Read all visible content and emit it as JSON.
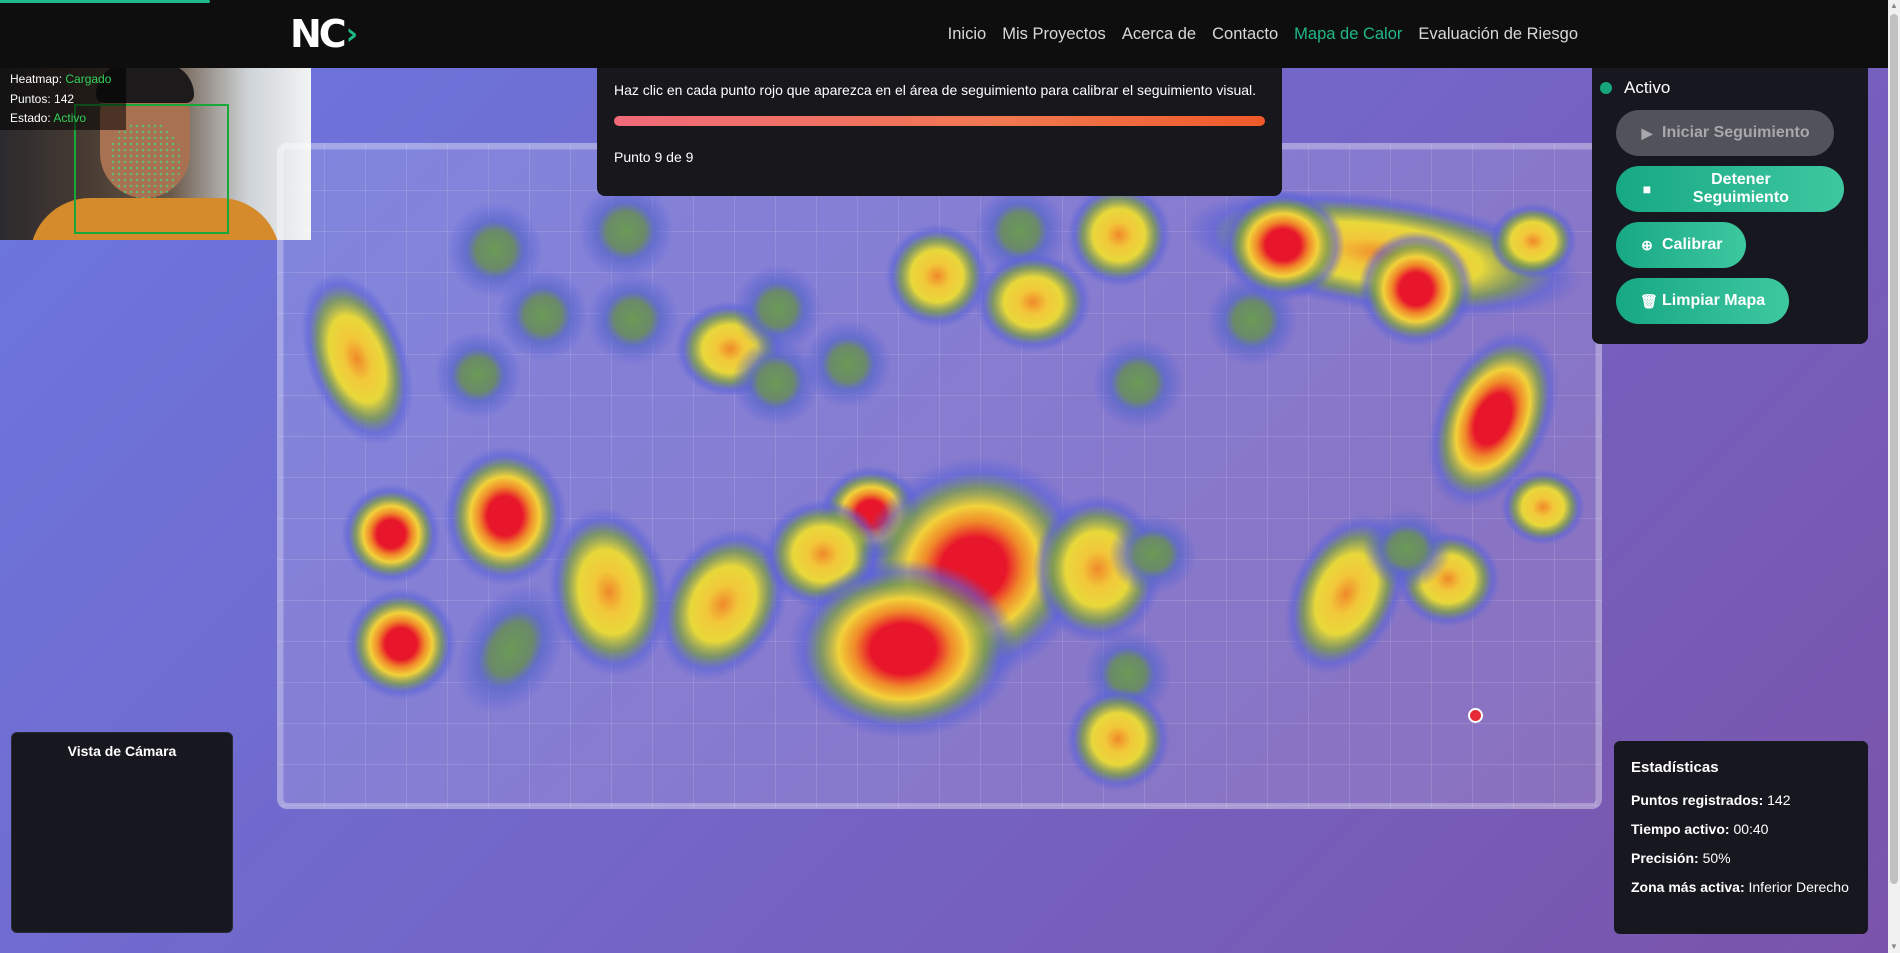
{
  "nav": {
    "logo": "NC",
    "links": [
      "Inicio",
      "Mis Proyectos",
      "Acerca de",
      "Contacto",
      "Mapa de Calor",
      "Evaluación de Riesgo"
    ],
    "active": "Mapa de Calor"
  },
  "camera_overlay": {
    "heatmap_label": "Heatmap:",
    "heatmap_value": "Cargado",
    "points_label": "Puntos:",
    "points_value": "142",
    "state_label": "Estado:",
    "state_value": "Activo"
  },
  "instructions": {
    "text": "Haz clic en cada punto rojo que aparezca en el área de seguimiento para calibrar el seguimiento visual.",
    "progress": 1.0,
    "point_label": "Punto 9 de 9"
  },
  "controls": {
    "status": "Activo",
    "start_label": "Iniciar Seguimiento",
    "stop_label": "Detener Seguimiento",
    "calibrate_label": "Calibrar",
    "clear_label": "Limpiar Mapa"
  },
  "camera_view": {
    "title": "Vista de Cámara"
  },
  "stats": {
    "title": "Estadísticas",
    "points_label": "Puntos registrados:",
    "points_value": "142",
    "time_label": "Tiempo activo:",
    "time_value": "00:40",
    "precision_label": "Precisión:",
    "precision_value": "50%",
    "zone_label": "Zona más activa:",
    "zone_value": "Inferior Derecho"
  },
  "colors": {
    "accent": "#1fb889",
    "heat_hot": "#e8162a",
    "heat_warm": "#f2d23a",
    "heat_cool": "#5e8a5a",
    "heat_halo": "#6a6fe0"
  }
}
